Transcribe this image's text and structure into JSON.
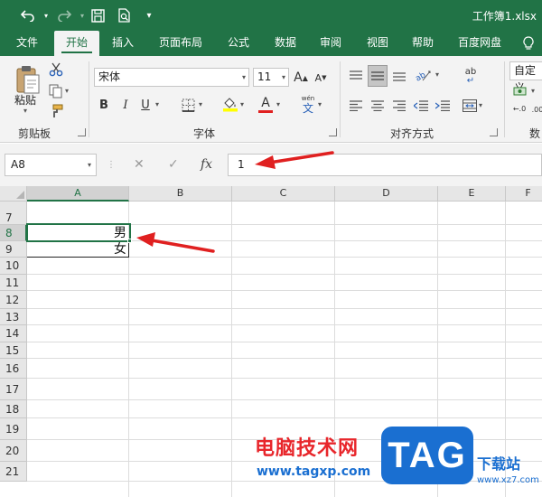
{
  "title_bar": {
    "file_name": "工作簿1.xlsx",
    "icons": [
      "undo-icon",
      "redo-icon",
      "save-icon",
      "print-preview-icon",
      "customize-toolbar-icon"
    ]
  },
  "tabs": [
    {
      "label": "文件"
    },
    {
      "label": "开始",
      "active": true
    },
    {
      "label": "插入"
    },
    {
      "label": "页面布局"
    },
    {
      "label": "公式"
    },
    {
      "label": "数据"
    },
    {
      "label": "审阅"
    },
    {
      "label": "视图"
    },
    {
      "label": "帮助"
    },
    {
      "label": "百度网盘"
    }
  ],
  "ribbon": {
    "clipboard": {
      "paste_label": "粘贴",
      "group_label": "剪贴板"
    },
    "font": {
      "font_name": "宋体",
      "font_size": "11",
      "grow_label": "A",
      "shrink_label": "A",
      "bold": "B",
      "italic": "I",
      "underline": "U",
      "font_color_label": "A",
      "phonetic_label": "wén",
      "phonetic_char": "文",
      "group_label": "字体"
    },
    "alignment": {
      "group_label": "对齐方式",
      "wrap_label": "ab"
    },
    "number": {
      "format": "自定义",
      "group_label": "数",
      "dec_inc": "←.0",
      "dec_dec": ".00"
    }
  },
  "formula_bar": {
    "name_box": "A8",
    "cancel": "✕",
    "enter": "✓",
    "fx": "fx",
    "content": "1"
  },
  "sheet": {
    "columns": [
      "A",
      "B",
      "C",
      "D",
      "E",
      "F"
    ],
    "rows": [
      "7",
      "8",
      "9",
      "10",
      "11",
      "12",
      "13",
      "14",
      "15",
      "16",
      "17",
      "18",
      "19",
      "20",
      "21"
    ],
    "cells": {
      "A8": "男",
      "A9": "女"
    },
    "selected_cell": "A8"
  },
  "watermark": {
    "cn_text": "电脑技术网",
    "url": "www.tagxp.com",
    "logo_text": "TAG",
    "site_text": "下载站",
    "site_url": "www.xz7.com"
  },
  "colors": {
    "excel_green": "#217346",
    "arrow_red": "#e02020",
    "watermark_red": "#e8262b",
    "watermark_blue": "#1a6fd1"
  }
}
